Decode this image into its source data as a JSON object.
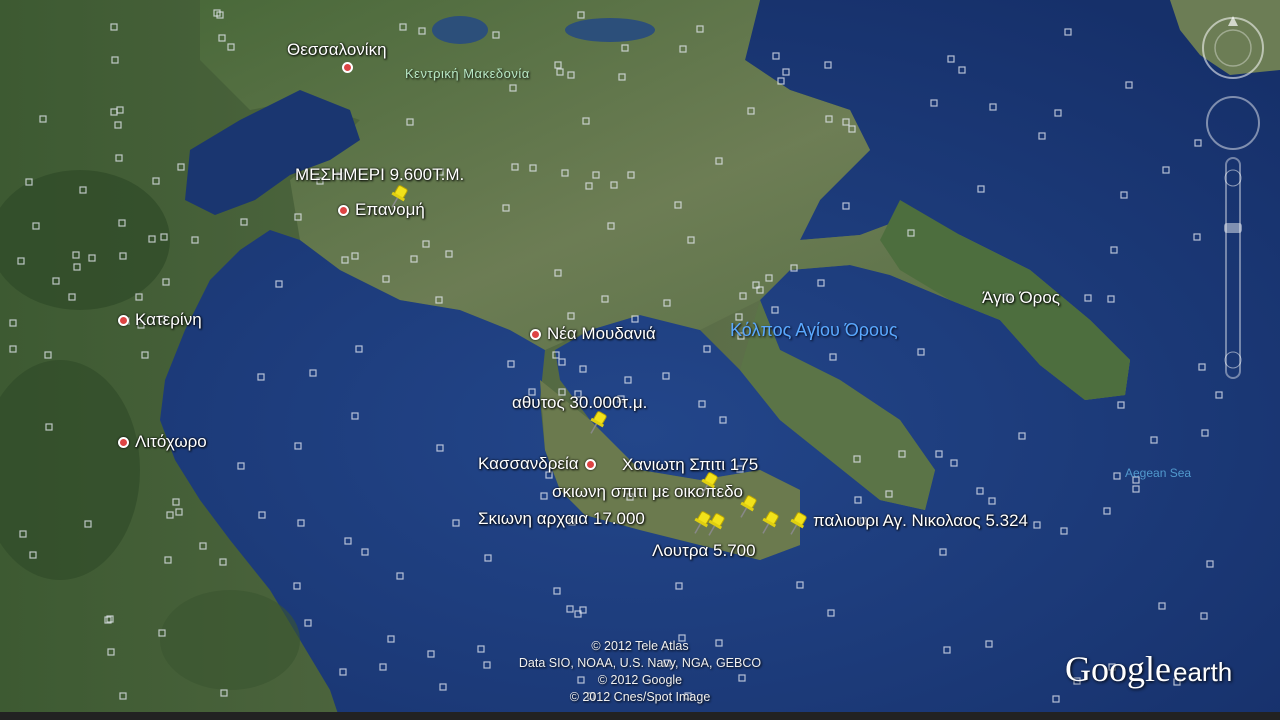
{
  "places": [
    {
      "name": "Θεσσαλονίκη"
    },
    {
      "name": "Επανομή"
    },
    {
      "name": "Κατερίνη"
    },
    {
      "name": "Λιτόχωρο"
    },
    {
      "name": "Νέα Μουδανιά"
    },
    {
      "name": "Κασσανδρεία"
    }
  ],
  "region_label": "Κεντρική Μακεδονία",
  "sea_labels": {
    "gulf": "Κόλπος Αγίου Όρους",
    "aegean": "Aegean Sea",
    "athos": "Άγιο Όρος"
  },
  "poi_labels": {
    "mesimeri": "ΜΕΣΗΜΕΡΙ 9.600Τ.Μ.",
    "athytos": "αθυτος 30.000τ.μ.",
    "chaniotis": "Χανιωτη Σπιτι 175",
    "skioni_house": "σκιωνη σπιτι με οικοπεδο",
    "skioni_ancient": "Σκιωνη αρχαια 17.000",
    "paliouri": "παλιουρι Αγ. Νικολαος 5.324",
    "loutra": "Λουτρα 5.700"
  },
  "credits": [
    "© 2012 Tele Atlas",
    "Data SIO, NOAA, U.S. Navy, NGA, GEBCO",
    "© 2012 Google",
    "© 2012 Cnes/Spot Image"
  ],
  "logo": {
    "google": "Google",
    "earth": "earth"
  },
  "colors": {
    "sea": "#1d3a78",
    "land": "#56704a",
    "pin": "#f2e21a",
    "place_dot": "#d44444"
  },
  "icons": [
    "pushpin-icon",
    "place-dot-icon",
    "navigation-compass-icon",
    "zoom-control-icon"
  ]
}
